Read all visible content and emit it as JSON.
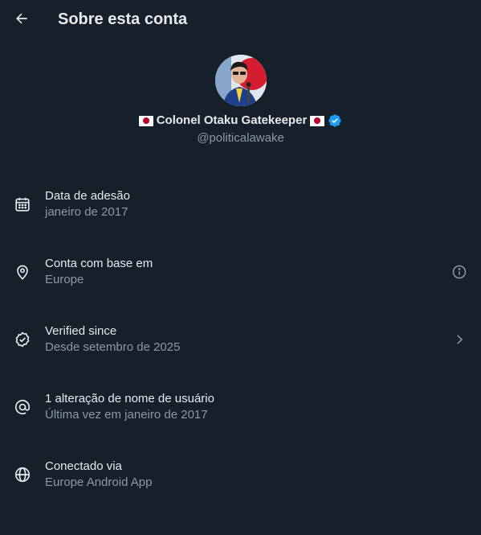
{
  "header": {
    "title": "Sobre esta conta",
    "back_icon": "arrow-left-icon"
  },
  "profile": {
    "display_name": "Colonel Otaku Gatekeeper",
    "handle": "@politicalawake",
    "badge": "verified-badge-icon",
    "flag": "japan-flag",
    "accent_color": "#1d9bf0"
  },
  "details": [
    {
      "icon": "calendar-icon",
      "label": "Data de adesão",
      "value": "janeiro de 2017",
      "action": null
    },
    {
      "icon": "location-pin-icon",
      "label": "Conta com base em",
      "value": "Europe",
      "action": "info-icon"
    },
    {
      "icon": "verified-check-icon",
      "label": "Verified since",
      "value": "Desde setembro de 2025",
      "action": "chevron-right-icon"
    },
    {
      "icon": "at-sign-icon",
      "label": "1 alteração de nome de usuário",
      "value": "Última vez em janeiro de 2017",
      "action": null
    },
    {
      "icon": "globe-icon",
      "label": "Conectado via",
      "value": "Europe Android App",
      "action": null
    }
  ],
  "colors": {
    "background": "#15202b",
    "primary_text": "#e7e9ea",
    "secondary_text": "#8b98a5"
  }
}
